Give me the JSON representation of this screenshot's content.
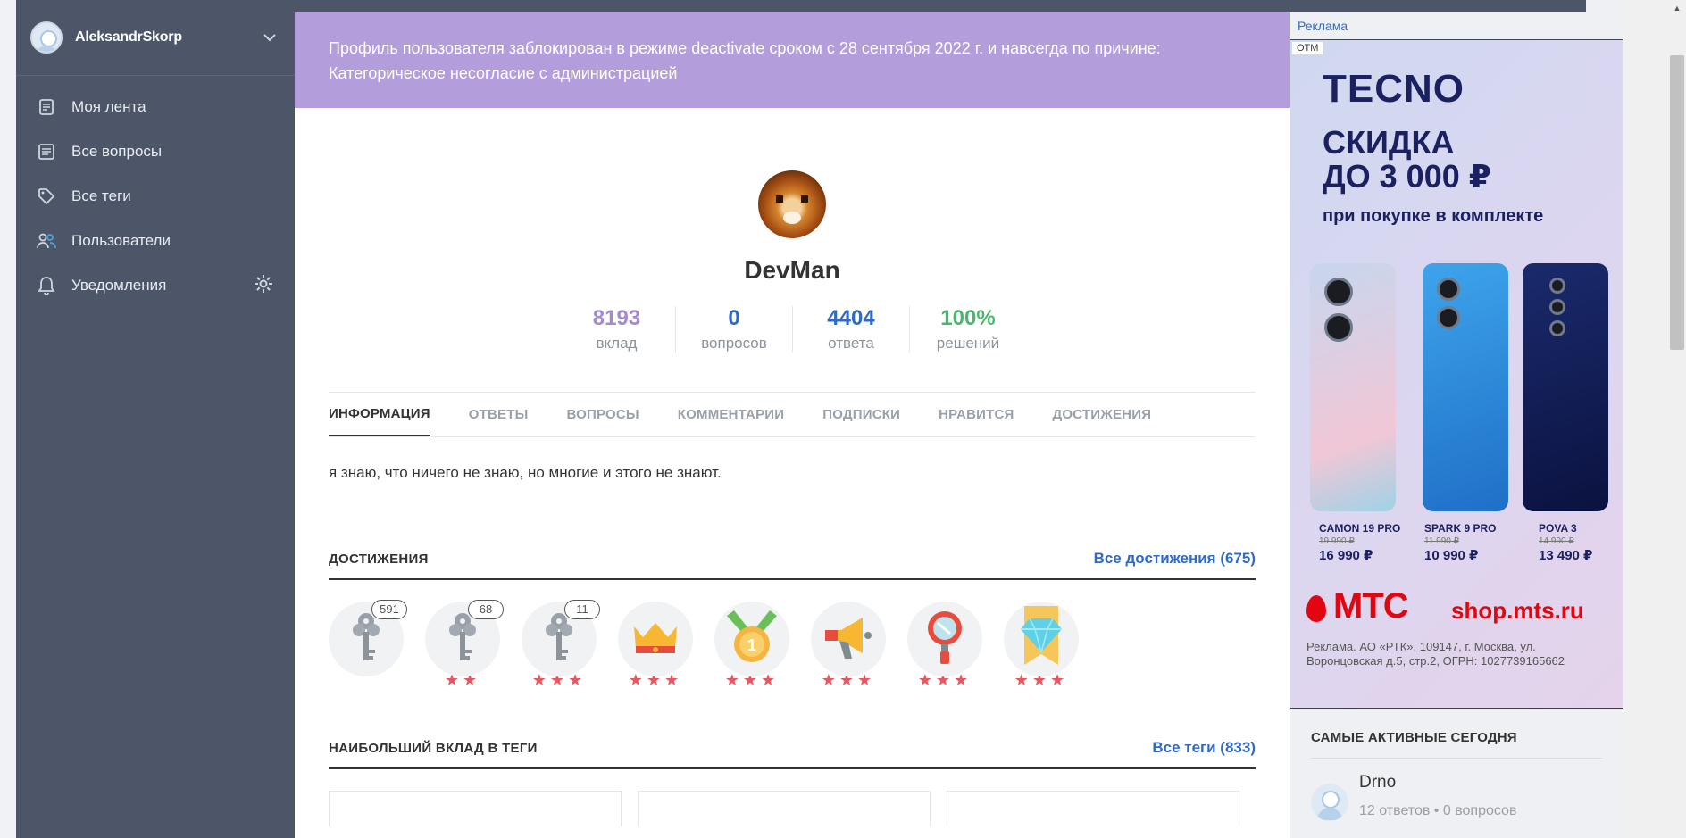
{
  "sidebar": {
    "username": "AleksandrSkorp",
    "items": [
      {
        "label": "Моя лента",
        "icon": "feed-icon"
      },
      {
        "label": "Все вопросы",
        "icon": "questions-icon"
      },
      {
        "label": "Все теги",
        "icon": "tag-icon"
      },
      {
        "label": "Пользователи",
        "icon": "users-icon"
      },
      {
        "label": "Уведомления",
        "icon": "bell-icon"
      }
    ]
  },
  "banner": {
    "text1": "Профиль пользователя заблокирован в режиме deactivate сроком с 28 сентября 2022 г. и навсегда по причине:",
    "text2": "Категорическое несогласие с администрацией"
  },
  "profile": {
    "name": "DevMan",
    "stats": [
      {
        "value": "8193",
        "label": "вклад",
        "color": "#a48ad4"
      },
      {
        "value": "0",
        "label": "вопросов",
        "color": "#2f6bc4"
      },
      {
        "value": "4404",
        "label": "ответа",
        "color": "#2f6bc4"
      },
      {
        "value": "100%",
        "label": "решений",
        "color": "#4cb66f"
      }
    ]
  },
  "tabs": [
    "ИНФОРМАЦИЯ",
    "ОТВЕТЫ",
    "ВОПРОСЫ",
    "КОММЕНТАРИИ",
    "ПОДПИСКИ",
    "НРАВИТСЯ",
    "ДОСТИЖЕНИЯ"
  ],
  "about": "я знаю, что ничего не знаю, но многие и этого не знают.",
  "achievements": {
    "title": "ДОСТИЖЕНИЯ",
    "link": "Все достижения (675)",
    "items": [
      {
        "icon": "key-icon",
        "badge": "591",
        "stars": ""
      },
      {
        "icon": "key-icon",
        "badge": "68",
        "stars": "★★"
      },
      {
        "icon": "key-icon",
        "badge": "11",
        "stars": "★★★"
      },
      {
        "icon": "crown-icon",
        "badge": "",
        "stars": "★★★"
      },
      {
        "icon": "medal-icon",
        "badge": "",
        "stars": "★★★"
      },
      {
        "icon": "megaphone-icon",
        "badge": "",
        "stars": "★★★"
      },
      {
        "icon": "magnifier-icon",
        "badge": "",
        "stars": "★★★"
      },
      {
        "icon": "diamond-icon",
        "badge": "",
        "stars": "★★★"
      }
    ]
  },
  "tags_section": {
    "title": "НАИБОЛЬШИЙ ВКЛАД В ТЕГИ",
    "link": "Все теги (833)"
  },
  "ad": {
    "label": "Реклама",
    "otm": "OTM",
    "brand": "TECNO",
    "headline1": "СКИДКА",
    "headline2": "ДО 3 000 ₽",
    "sub": "при покупке в комплекте",
    "phones": [
      {
        "model": "CAMON 19 PRO",
        "old": "19 990 ₽",
        "price": "16 990 ₽"
      },
      {
        "model": "SPARK 9 PRO",
        "old": "11 990 ₽",
        "price": "10 990 ₽"
      },
      {
        "model": "POVA 3",
        "old": "14 990 ₽",
        "price": "13 490 ₽"
      }
    ],
    "mts": "МТС",
    "site": "shop.mts.ru",
    "legal": "Реклама. АО «РТК», 109147, г. Москва, ул. Воронцовская д.5, стр.2, ОГРН: 1027739165662"
  },
  "active": {
    "title": "САМЫЕ АКТИВНЫЕ СЕГОДНЯ",
    "user": "Drno",
    "meta": "12 ответов • 0 вопросов"
  },
  "colors": {
    "sidebar": "#4d5669",
    "banner": "#b39ddb",
    "link": "#2f6bc4",
    "star": "#e8575f"
  }
}
